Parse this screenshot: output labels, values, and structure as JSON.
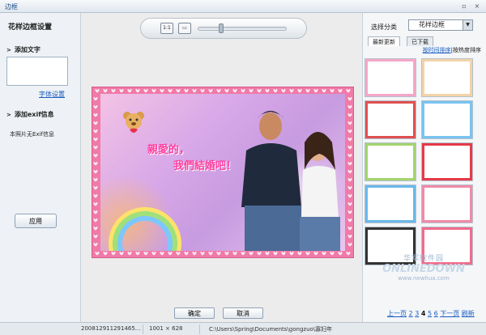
{
  "window": {
    "title": "边框",
    "min_label": "▫",
    "close_label": "×"
  },
  "left_panel": {
    "heading": "花样边框设置",
    "add_text_label": "添加文字",
    "font_settings_link": "字体设置",
    "add_exif_label": "添加exif信息",
    "no_exif_text": "本照片无Exif信息",
    "apply_button": "应用"
  },
  "toolbar": {
    "fit_button_label": "1:1",
    "screen_button_label": "▭",
    "zoom_level": 0.25
  },
  "canvas": {
    "text_line1": "親愛的，",
    "text_line2": "我們結婚吧！"
  },
  "actions": {
    "ok_button": "确定",
    "cancel_button": "取消"
  },
  "right_panel": {
    "category_label": "选择分类",
    "category_value": "花样边框",
    "tabs": [
      {
        "label": "最新更新",
        "active": true
      },
      {
        "label": "已下载",
        "active": false
      }
    ],
    "sort_by_time": "按时间排序",
    "sort_separator": "|",
    "sort_by_popularity": "按热度排序",
    "pager": {
      "prev": "上一页",
      "pages": [
        "2",
        "3",
        "4",
        "5",
        "6"
      ],
      "current": "4",
      "next": "下一页",
      "refresh": "刷新"
    },
    "watermark": {
      "line1": "华军软件园",
      "line2": "ONLINEDOWN",
      "line3": "www.newhua.com"
    },
    "thumb_colors": [
      "#f5a7c8",
      "#f2d3a8",
      "#e05050",
      "#78c4ef",
      "#a4d46e",
      "#e63a4a",
      "#6ab8ea",
      "#f08aa8",
      "#333333",
      "#f06c8c"
    ]
  },
  "status": {
    "filename": "200812911291465...",
    "dimensions": "1001 × 628",
    "path": "C:\\Users\\Spring\\Documents\\gongzuo\\寡妇年"
  }
}
